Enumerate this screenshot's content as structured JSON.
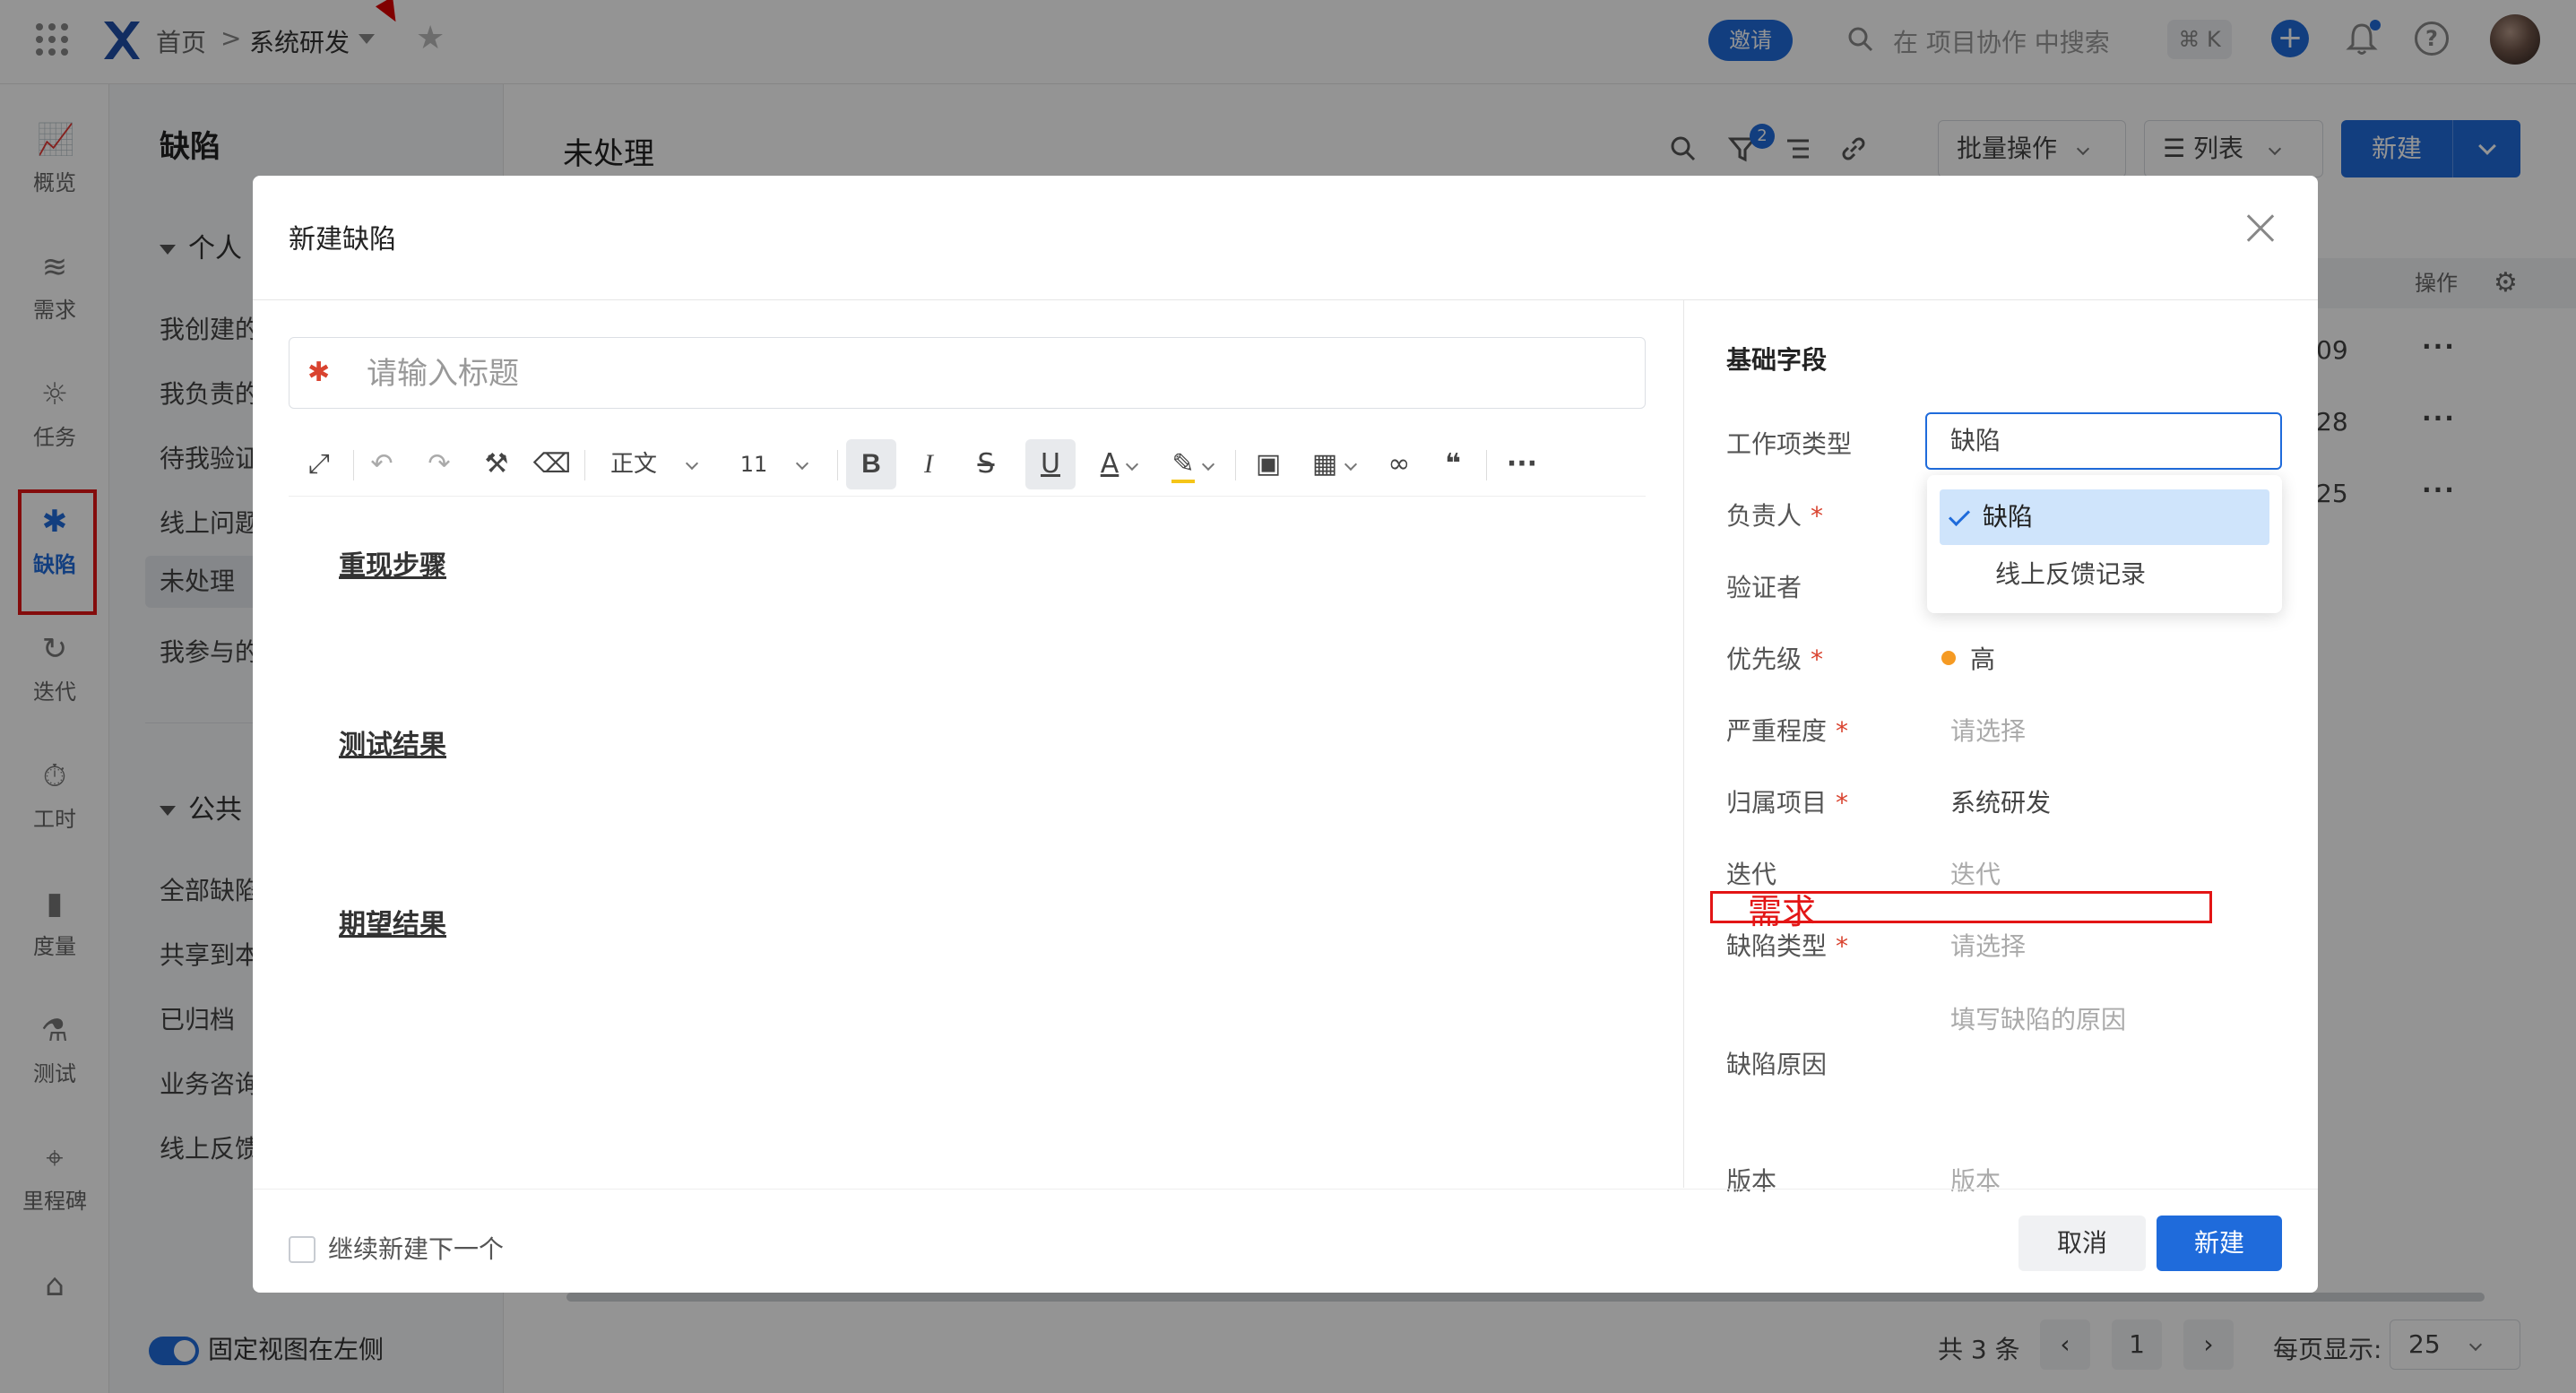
{
  "topbar": {
    "breadcrumb_home": "首页",
    "breadcrumb_sep": ">",
    "project_name": "系统研发",
    "invite_label": "邀请",
    "search_placeholder": "在 项目协作 中搜索",
    "shortcut": "⌘ K"
  },
  "leftnav": {
    "items": [
      {
        "label": "概览",
        "icon": "chart-line-icon"
      },
      {
        "label": "需求",
        "icon": "layers-icon"
      },
      {
        "label": "任务",
        "icon": "lightbulb-icon"
      },
      {
        "label": "缺陷",
        "icon": "bug-icon"
      },
      {
        "label": "迭代",
        "icon": "cycle-icon"
      },
      {
        "label": "工时",
        "icon": "stopwatch-icon"
      },
      {
        "label": "度量",
        "icon": "bar-chart-icon"
      },
      {
        "label": "测试",
        "icon": "flask-icon"
      },
      {
        "label": "里程碑",
        "icon": "map-pin-icon"
      }
    ],
    "active_index": 3
  },
  "sidebar": {
    "title": "缺陷",
    "group_personal": "个人",
    "personal_items": [
      "我创建的",
      "我负责的",
      "待我验证",
      "线上问题",
      "未处理",
      "我参与的"
    ],
    "group_public": "公共",
    "public_items": [
      "全部缺陷",
      "共享到本",
      "已归档",
      "业务咨询",
      "线上反馈"
    ],
    "pin_label": "固定视图在左侧"
  },
  "main": {
    "title": "未处理",
    "filter_count": "2",
    "bulk_label": "批量操作",
    "view_label": "列表",
    "new_label": "新建",
    "ops_header": "操作",
    "row_suffixes": [
      "09",
      "28",
      "25"
    ],
    "row_menu": "···",
    "total": "共 3 条",
    "page": "1",
    "per_page_label": "每页显示:",
    "per_page_value": "25"
  },
  "modal": {
    "title": "新建缺陷",
    "title_placeholder": "请输入标题",
    "toolbar": {
      "style": "正文",
      "size": "11",
      "more": "···"
    },
    "sections": [
      "重现步骤",
      "测试结果",
      "期望结果"
    ],
    "fields_title": "基础字段",
    "fields": {
      "type_label": "工作项类型",
      "type_value": "缺陷",
      "assignee_label": "负责人",
      "verifier_label": "验证者",
      "priority_label": "优先级",
      "priority_value": "高",
      "severity_label": "严重程度",
      "severity_placeholder": "请选择",
      "project_label": "归属项目",
      "project_value": "系统研发",
      "iteration_label": "迭代",
      "iteration_placeholder": "迭代",
      "defect_type_label": "缺陷类型",
      "defect_type_placeholder": "请选择",
      "cause_label": "缺陷原因",
      "cause_placeholder": "填写缺陷的原因",
      "version_label": "版本",
      "version_placeholder": "版本",
      "required_mark": "*"
    },
    "dropdown_options": [
      "缺陷",
      "线上反馈记录"
    ],
    "annotation": "需求",
    "continue_label": "继续新建下一个",
    "cancel_label": "取消",
    "create_label": "新建"
  },
  "colors": {
    "primary": "#1f6bdb",
    "danger": "#d9432f",
    "priority_high": "#f59a23",
    "annotation": "#e31515"
  }
}
